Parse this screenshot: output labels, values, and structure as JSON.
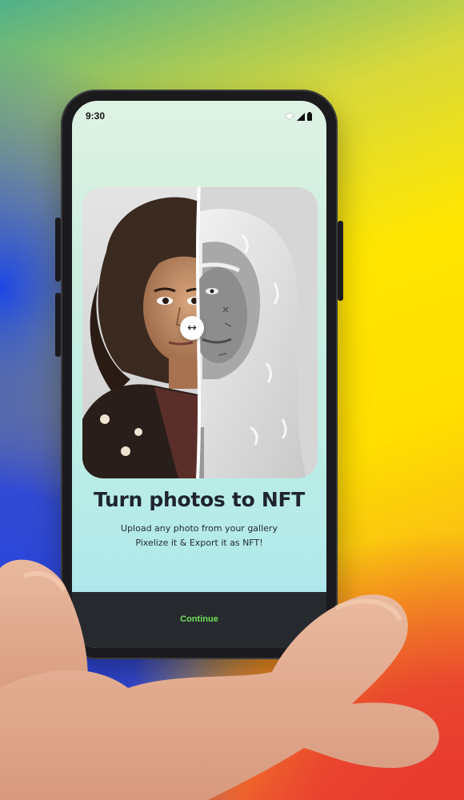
{
  "status_bar": {
    "time": "9:30",
    "icons": [
      "wifi-icon",
      "cellular-signal-icon",
      "battery-icon"
    ]
  },
  "compare": {
    "handle_glyph": "↔",
    "handle_icon": "left-right-arrow-icon"
  },
  "onboarding": {
    "title": "Turn photos to NFT",
    "subtitle_line1": "Upload any photo from your gallery",
    "subtitle_line2": "Pixelize it & Export it as NFT!"
  },
  "footer": {
    "continue_label": "Continue"
  },
  "colors": {
    "accent_green": "#6fe05a",
    "footer_bg": "#262a2e",
    "title_text": "#1e2430",
    "phone_frame": "#1b1b1d"
  }
}
